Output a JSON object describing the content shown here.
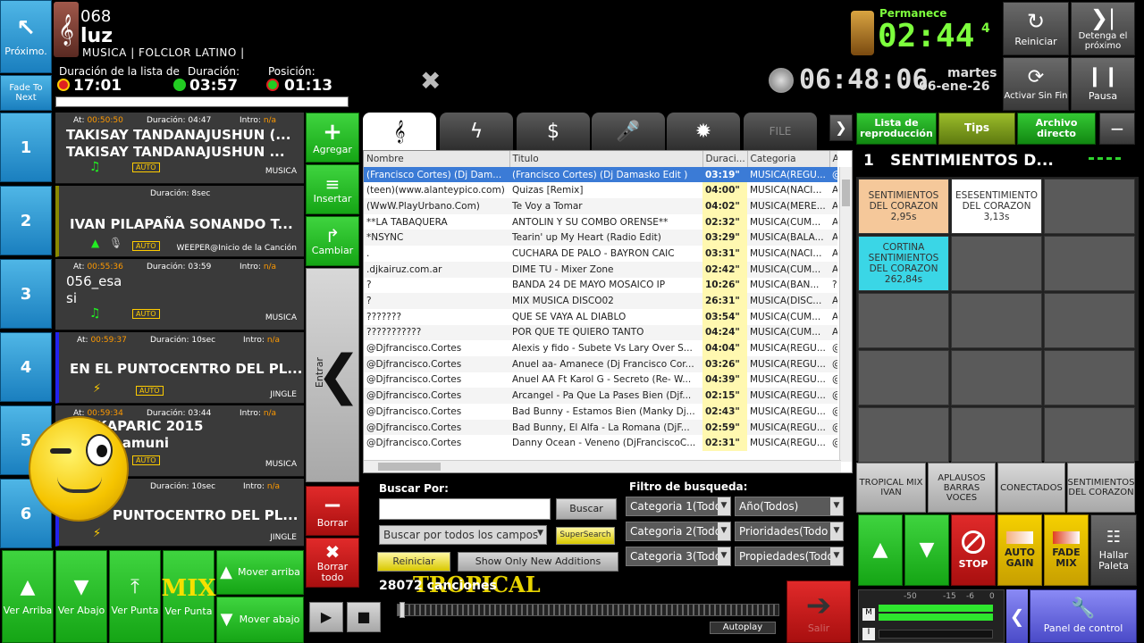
{
  "top": {
    "next_label": "Próximo.",
    "track_num": "068",
    "track_name": "luz",
    "track_category": "MUSICA | FOLCLOR LATINO |",
    "fade_label": "Fade To Next",
    "list_dur_label": "Duración de la lista de",
    "list_dur": "17:01",
    "dur_label": "Duración:",
    "dur": "03:57",
    "pos_label": "Posición:",
    "pos": "01:13",
    "permanece_label": "Permanece",
    "permanece": "02:44",
    "permanece_frac": "4",
    "clock": "06:48:06",
    "day": "martes",
    "date": "06-ene-26",
    "reiniciar": "Reiniciar",
    "detenga": "Detenga el próximo",
    "activar": "Activar Sin Fin",
    "pausa": "Pausa"
  },
  "queue": [
    {
      "num": "1",
      "at_label": "At:",
      "at": "00:50:50",
      "dur_label": "Duración:",
      "dur": "04:47",
      "intro_label": "Intro:",
      "intro": "n/a",
      "title1": "TAKISAY TANDANAJUSHUN (...",
      "title2": "TAKISAY  TANDANAJUSHUN ...",
      "auto": "AUTO",
      "cat": "MUSICA"
    },
    {
      "num": "2",
      "dur_label": "Duración:",
      "dur": "8sec",
      "title1": "IVAN PILAPAÑA SONANDO T...",
      "auto": "AUTO",
      "cat": "WEEPER@Inicio de la Canción"
    },
    {
      "num": "3",
      "at_label": "At:",
      "at": "00:55:36",
      "dur_label": "Duración:",
      "dur": "03:59",
      "intro_label": "Intro:",
      "intro": "n/a",
      "title1": "056_esa",
      "title2": "si",
      "auto": "AUTO",
      "cat": "MUSICA"
    },
    {
      "num": "4",
      "at_label": "At:",
      "at": "00:59:37",
      "dur_label": "Duración:",
      "dur": "10sec",
      "intro_label": "Intro:",
      "intro": "n/a",
      "title1": "EN EL PUNTOCENTRO DEL PL...",
      "auto": "AUTO",
      "cat": "JINGLE"
    },
    {
      "num": "5",
      "at_label": "At:",
      "at": "00:59:34",
      "dur_label": "Duración:",
      "dur": "03:44",
      "intro_label": "Intro:",
      "intro": "n/a",
      "title1": "...A KAPARIC 2015",
      "title2": "...da shamuni",
      "auto": "AUTO",
      "cat": "MUSICA"
    },
    {
      "num": "6",
      "dur_label": "Duración:",
      "dur": "10sec",
      "intro_label": "Intro:",
      "intro": "n/a",
      "title1": "PUNTOCENTRO DEL PL...",
      "cat": "JINGLE"
    }
  ],
  "side_buttons": {
    "agregar": "Agregar",
    "insertar": "Insertar",
    "cambiar": "Cambiar",
    "entrar": "Entrar",
    "borrar": "Borrar",
    "borrar_todo": "Borrar todo"
  },
  "bottom_left": {
    "ver_arriba": "Ver Arriba",
    "ver_abajo": "Ver Abajo",
    "ver_punta": "Ver Punta",
    "ver_punta2": "Ver Punta",
    "mover_arriba": "Mover arriba",
    "mover_abajo": "Mover abajo",
    "mix_text": "MIX"
  },
  "tabs": {
    "file": "FILE"
  },
  "list": {
    "headers": [
      "Nombre",
      "Titulo",
      "Duraci...",
      "Categoria",
      "A"
    ],
    "rows": [
      [
        "(Francisco Cortes) (Dj Dam...",
        "(Francisco Cortes) (Dj Damasko Edit )",
        "03:19\"",
        "MUSICA(REGU...",
        "@"
      ],
      [
        "(teen)(www.alanteypico.com)",
        "Quizas [Remix]",
        "04:00\"",
        "MUSICA(NACI...",
        "A"
      ],
      [
        "(WwW.PlayUrbano.Com)",
        "Te Voy a Tomar",
        "04:02\"",
        "MUSICA(MERE...",
        "A"
      ],
      [
        "**LA TABAQUERA",
        "ANTOLIN Y SU COMBO ORENSE**",
        "02:32\"",
        "MUSICA(CUM...",
        "A"
      ],
      [
        "*NSYNC",
        "Tearin' up My Heart (Radio Edit)",
        "03:29\"",
        "MUSICA(BALA...",
        "A"
      ],
      [
        ".",
        "CUCHARA DE PALO - BAYRON CAIC",
        "03:31\"",
        "MUSICA(NACI...",
        "A"
      ],
      [
        ".djkairuz.com.ar",
        "DIME TU - Mixer Zone",
        "02:42\"",
        "MUSICA(CUM...",
        "A"
      ],
      [
        "?",
        "BANDA 24 DE MAYO MOSAICO IP",
        "10:26\"",
        "MUSICA(BAN...",
        "?"
      ],
      [
        "?",
        "MIX MUSICA DISCO02",
        "26:31\"",
        "MUSICA(DISC...",
        "A"
      ],
      [
        "???????",
        "QUE SE VAYA AL DIABLO",
        "03:54\"",
        "MUSICA(CUM...",
        "A"
      ],
      [
        "???????????",
        "POR QUE TE QUIERO TANTO",
        "04:24\"",
        "MUSICA(CUM...",
        "A"
      ],
      [
        "@Djfrancisco.Cortes",
        "Alexis y fido - Subete Vs Lary Over S...",
        "04:04\"",
        "MUSICA(REGU...",
        "@"
      ],
      [
        "@Djfrancisco.Cortes",
        "Anuel aa- Amanece (Dj Francisco Cor...",
        "03:26\"",
        "MUSICA(REGU...",
        "@"
      ],
      [
        "@Djfrancisco.Cortes",
        "Anuel AA Ft Karol G - Secreto (Re- W...",
        "04:39\"",
        "MUSICA(REGU...",
        "@"
      ],
      [
        "@Djfrancisco.Cortes",
        "Arcangel - Pa Que La Pases Bien (Djf...",
        "02:15\"",
        "MUSICA(REGU...",
        "@"
      ],
      [
        "@Djfrancisco.Cortes",
        "Bad Bunny - Estamos Bien (Manky Dj...",
        "02:43\"",
        "MUSICA(REGU...",
        "@"
      ],
      [
        "@Djfrancisco.Cortes",
        "Bad Bunny, El Alfa - La Romana (DjF...",
        "02:59\"",
        "MUSICA(REGU...",
        "@"
      ],
      [
        "@Djfrancisco.Cortes",
        "Danny Ocean - Veneno (DjFranciscoC...",
        "02:31\"",
        "MUSICA(REGU...",
        "@"
      ]
    ]
  },
  "search": {
    "buscar_por": "Buscar Por:",
    "buscar": "Buscar",
    "scope": "Buscar por todos los campos",
    "supersearch": "SuperSearch",
    "reiniciar": "Reiniciar",
    "show_new": "Show Only New Additions",
    "count": "28072 canciones",
    "tropical": "TROPICAL",
    "filter_label": "Filtro de busqueda:",
    "cat1": "Categoria 1(Todo",
    "cat2": "Categoria 2(Todo",
    "cat3": "Categoria 3(Todo",
    "anio": "Año(Todos)",
    "prioridades": "Prioridades(Todo",
    "propiedades": "Propiedades(Todo",
    "autoplay": "Autoplay",
    "salir": "Salir"
  },
  "right": {
    "lista": "Lista de reproducción",
    "tips": "Tips",
    "archivo": "Archivo directo",
    "palette_num": "1",
    "palette_title": "SENTIMIENTOS D...",
    "cells": [
      {
        "t": "SENTIMIENTOS DEL CORAZON",
        "d": "2,95s"
      },
      {
        "t": "ESESENTIMIENTO DEL CORAZON",
        "d": "3,13s"
      },
      {
        "t": "CORTINA SENTIMIENTOS DEL CORAZON",
        "d": "262,84s"
      }
    ],
    "labels": [
      "TROPICAL MIX IVAN",
      "APLAUSOS BARRAS VOCES",
      "CONECTADOS",
      "SENTIMIENTOS DEL CORAZON"
    ],
    "stop": "STOP",
    "autogain": "AUTO GAIN",
    "fademix": "FADE MIX",
    "hallar": "Hallar Paleta",
    "panel": "Panel de control",
    "meter_ticks": [
      "-50",
      "-15",
      "-6",
      "0"
    ],
    "meter_m": "M",
    "meter_i": "I"
  }
}
